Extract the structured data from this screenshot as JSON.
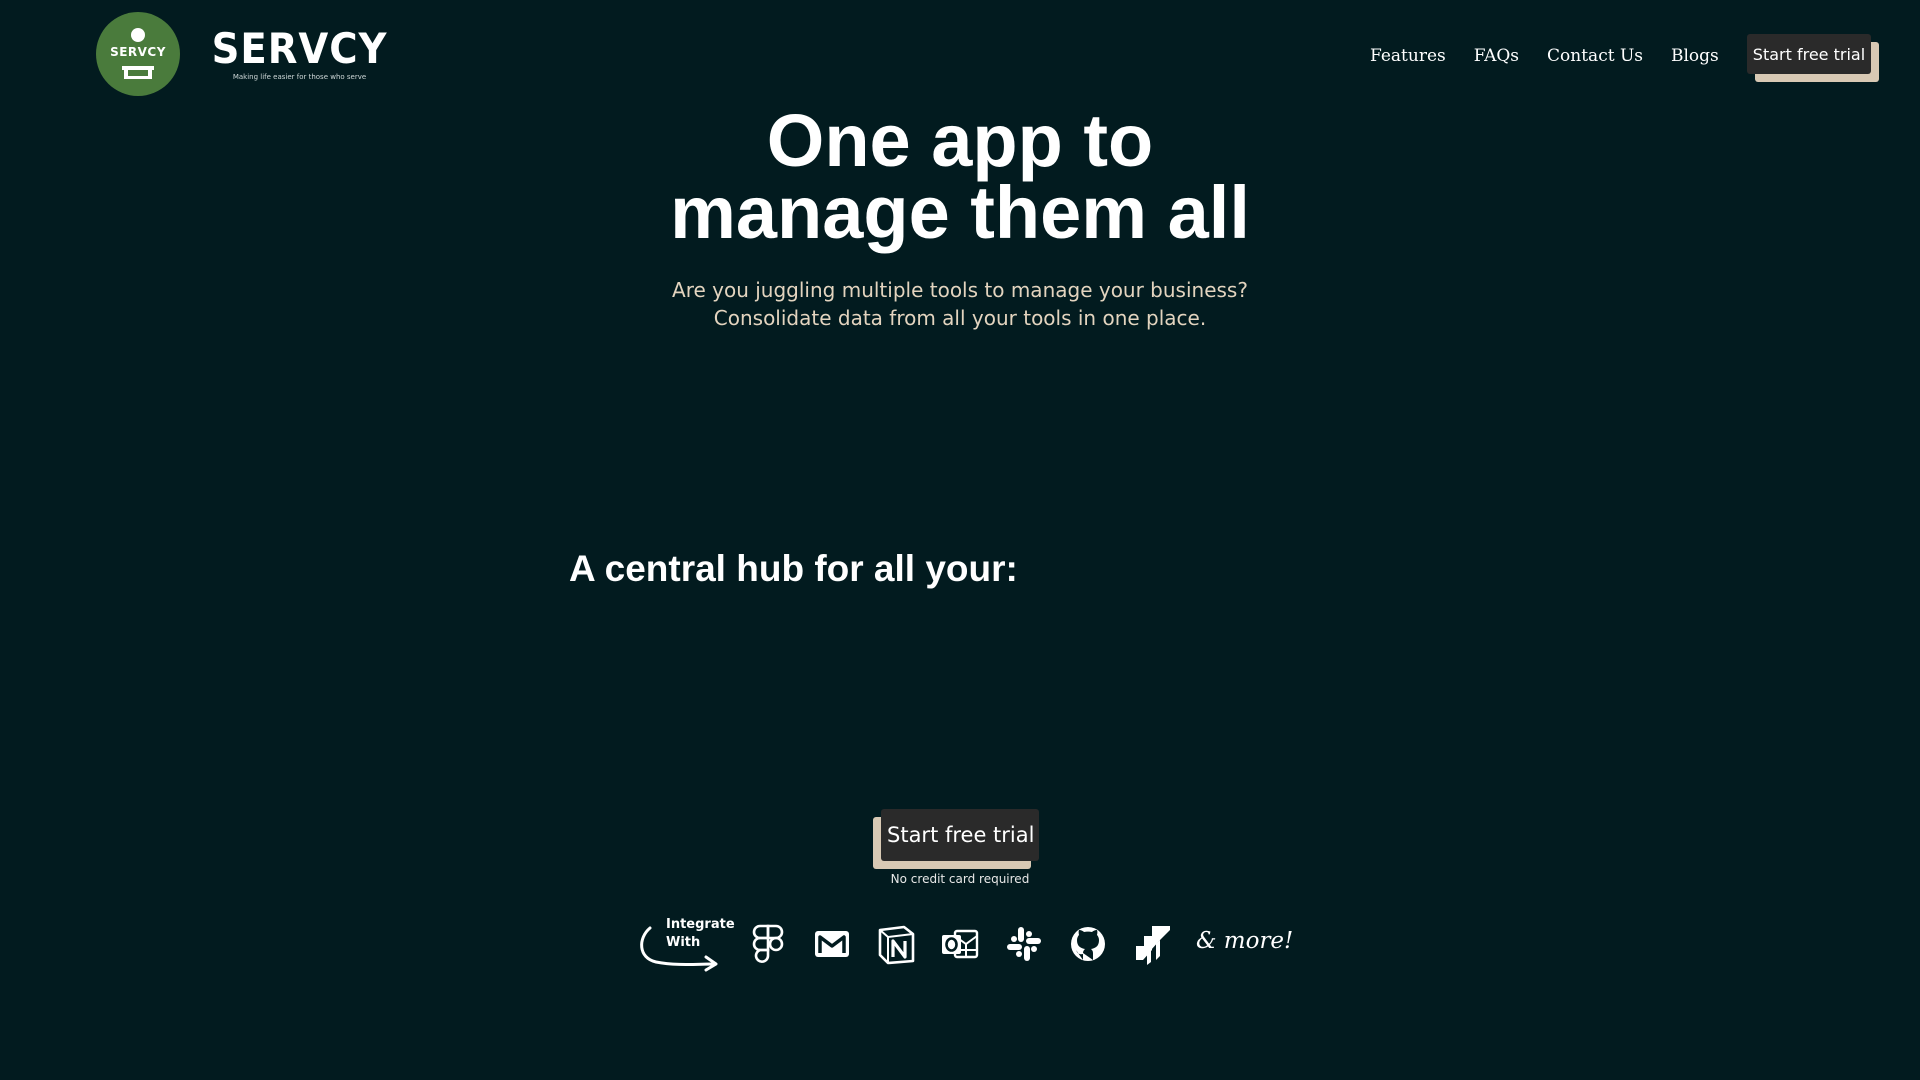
{
  "brand": {
    "name": "SERVCY",
    "badge_text": "SERVCY",
    "tagline": "Making life easier for those who serve"
  },
  "nav": {
    "links": [
      "Features",
      "FAQs",
      "Contact Us",
      "Blogs"
    ],
    "cta_label": "Start free trial"
  },
  "hero": {
    "title_line1": "One app to",
    "title_line2": "manage them all",
    "subtitle_line1": "Are you juggling multiple tools to manage your business?",
    "subtitle_line2": "Consolidate data from all your tools in one place."
  },
  "hub_heading": "A central hub for all your:",
  "cta": {
    "label": "Start free trial",
    "note": "No credit card required"
  },
  "integrations": {
    "label_line1": "Integrate",
    "label_line2": "With",
    "icons": [
      "figma-icon",
      "gmail-icon",
      "notion-icon",
      "outlook-icon",
      "slack-icon",
      "github-icon",
      "jira-icon"
    ],
    "more": "& more!"
  },
  "colors": {
    "background": "#021b1f",
    "button": "#2a2a2a",
    "button_shadow": "#d8c9b4",
    "subtitle": "#e3d4bf",
    "logo_green": "#4a7b3c"
  }
}
